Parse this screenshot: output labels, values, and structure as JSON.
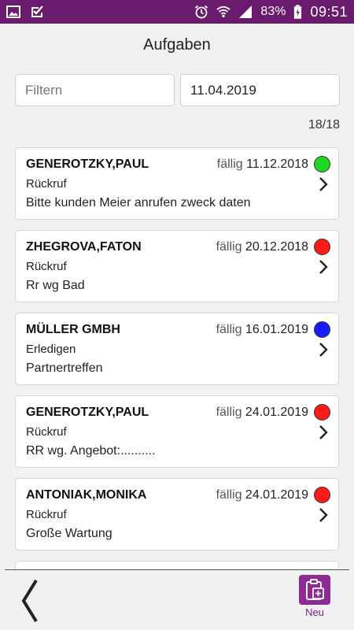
{
  "statusbar": {
    "battery": "83%",
    "time": "09:51"
  },
  "header": {
    "title": "Aufgaben"
  },
  "filter": {
    "placeholder": "Filtern",
    "value": ""
  },
  "date_field": {
    "value": "11.04.2019"
  },
  "count": "18/18",
  "due_prefix": "fällig",
  "tasks": [
    {
      "name": "GENEROTZKY,PAUL",
      "due": "11.12.2018",
      "type": "Rückruf",
      "description": "Bitte kunden Meier anrufen zweck daten",
      "status_color": "#22d622"
    },
    {
      "name": "ZHEGROVA,FATON",
      "due": "20.12.2018",
      "type": "Rückruf",
      "description": "Rr wg Bad",
      "status_color": "#ff1a1a"
    },
    {
      "name": "MÜLLER GMBH",
      "due": "16.01.2019",
      "type": "Erledigen",
      "description": "Partnertreffen",
      "status_color": "#1a1aff"
    },
    {
      "name": "GENEROTZKY,PAUL",
      "due": "24.01.2019",
      "type": "Rückruf",
      "description": "RR wg. Angebot:..........",
      "status_color": "#ff1a1a"
    },
    {
      "name": "ANTONIAK,MONIKA",
      "due": "24.01.2019",
      "type": "Rückruf",
      "description": "Große Wartung",
      "status_color": "#ff1a1a"
    }
  ],
  "partial_task": {
    "status_color": "#ff1a1a"
  },
  "bottom": {
    "new_label": "Neu"
  },
  "colors": {
    "statusbar": "#6a1b6e",
    "accent": "#8e2a94"
  }
}
